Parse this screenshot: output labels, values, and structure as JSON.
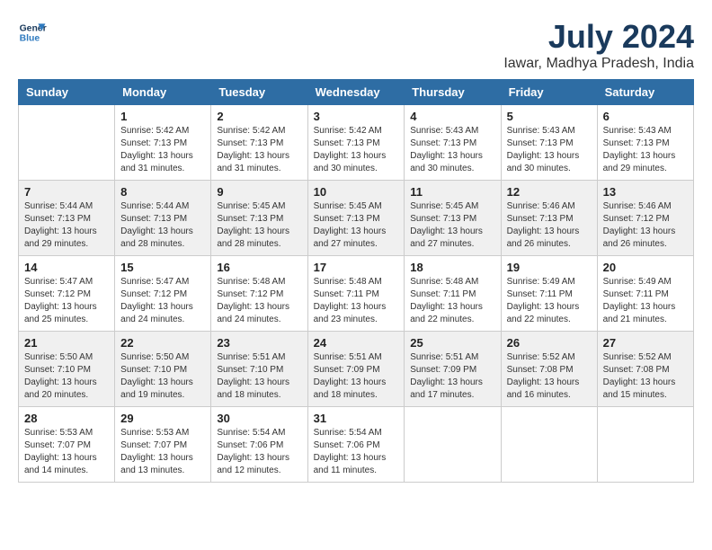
{
  "header": {
    "logo_line1": "General",
    "logo_line2": "Blue",
    "month_year": "July 2024",
    "location": "Iawar, Madhya Pradesh, India"
  },
  "days_of_week": [
    "Sunday",
    "Monday",
    "Tuesday",
    "Wednesday",
    "Thursday",
    "Friday",
    "Saturday"
  ],
  "weeks": [
    [
      {
        "day": "",
        "sunrise": "",
        "sunset": "",
        "daylight": ""
      },
      {
        "day": "1",
        "sunrise": "Sunrise: 5:42 AM",
        "sunset": "Sunset: 7:13 PM",
        "daylight": "Daylight: 13 hours and 31 minutes."
      },
      {
        "day": "2",
        "sunrise": "Sunrise: 5:42 AM",
        "sunset": "Sunset: 7:13 PM",
        "daylight": "Daylight: 13 hours and 31 minutes."
      },
      {
        "day": "3",
        "sunrise": "Sunrise: 5:42 AM",
        "sunset": "Sunset: 7:13 PM",
        "daylight": "Daylight: 13 hours and 30 minutes."
      },
      {
        "day": "4",
        "sunrise": "Sunrise: 5:43 AM",
        "sunset": "Sunset: 7:13 PM",
        "daylight": "Daylight: 13 hours and 30 minutes."
      },
      {
        "day": "5",
        "sunrise": "Sunrise: 5:43 AM",
        "sunset": "Sunset: 7:13 PM",
        "daylight": "Daylight: 13 hours and 30 minutes."
      },
      {
        "day": "6",
        "sunrise": "Sunrise: 5:43 AM",
        "sunset": "Sunset: 7:13 PM",
        "daylight": "Daylight: 13 hours and 29 minutes."
      }
    ],
    [
      {
        "day": "7",
        "sunrise": "Sunrise: 5:44 AM",
        "sunset": "Sunset: 7:13 PM",
        "daylight": "Daylight: 13 hours and 29 minutes."
      },
      {
        "day": "8",
        "sunrise": "Sunrise: 5:44 AM",
        "sunset": "Sunset: 7:13 PM",
        "daylight": "Daylight: 13 hours and 28 minutes."
      },
      {
        "day": "9",
        "sunrise": "Sunrise: 5:45 AM",
        "sunset": "Sunset: 7:13 PM",
        "daylight": "Daylight: 13 hours and 28 minutes."
      },
      {
        "day": "10",
        "sunrise": "Sunrise: 5:45 AM",
        "sunset": "Sunset: 7:13 PM",
        "daylight": "Daylight: 13 hours and 27 minutes."
      },
      {
        "day": "11",
        "sunrise": "Sunrise: 5:45 AM",
        "sunset": "Sunset: 7:13 PM",
        "daylight": "Daylight: 13 hours and 27 minutes."
      },
      {
        "day": "12",
        "sunrise": "Sunrise: 5:46 AM",
        "sunset": "Sunset: 7:13 PM",
        "daylight": "Daylight: 13 hours and 26 minutes."
      },
      {
        "day": "13",
        "sunrise": "Sunrise: 5:46 AM",
        "sunset": "Sunset: 7:12 PM",
        "daylight": "Daylight: 13 hours and 26 minutes."
      }
    ],
    [
      {
        "day": "14",
        "sunrise": "Sunrise: 5:47 AM",
        "sunset": "Sunset: 7:12 PM",
        "daylight": "Daylight: 13 hours and 25 minutes."
      },
      {
        "day": "15",
        "sunrise": "Sunrise: 5:47 AM",
        "sunset": "Sunset: 7:12 PM",
        "daylight": "Daylight: 13 hours and 24 minutes."
      },
      {
        "day": "16",
        "sunrise": "Sunrise: 5:48 AM",
        "sunset": "Sunset: 7:12 PM",
        "daylight": "Daylight: 13 hours and 24 minutes."
      },
      {
        "day": "17",
        "sunrise": "Sunrise: 5:48 AM",
        "sunset": "Sunset: 7:11 PM",
        "daylight": "Daylight: 13 hours and 23 minutes."
      },
      {
        "day": "18",
        "sunrise": "Sunrise: 5:48 AM",
        "sunset": "Sunset: 7:11 PM",
        "daylight": "Daylight: 13 hours and 22 minutes."
      },
      {
        "day": "19",
        "sunrise": "Sunrise: 5:49 AM",
        "sunset": "Sunset: 7:11 PM",
        "daylight": "Daylight: 13 hours and 22 minutes."
      },
      {
        "day": "20",
        "sunrise": "Sunrise: 5:49 AM",
        "sunset": "Sunset: 7:11 PM",
        "daylight": "Daylight: 13 hours and 21 minutes."
      }
    ],
    [
      {
        "day": "21",
        "sunrise": "Sunrise: 5:50 AM",
        "sunset": "Sunset: 7:10 PM",
        "daylight": "Daylight: 13 hours and 20 minutes."
      },
      {
        "day": "22",
        "sunrise": "Sunrise: 5:50 AM",
        "sunset": "Sunset: 7:10 PM",
        "daylight": "Daylight: 13 hours and 19 minutes."
      },
      {
        "day": "23",
        "sunrise": "Sunrise: 5:51 AM",
        "sunset": "Sunset: 7:10 PM",
        "daylight": "Daylight: 13 hours and 18 minutes."
      },
      {
        "day": "24",
        "sunrise": "Sunrise: 5:51 AM",
        "sunset": "Sunset: 7:09 PM",
        "daylight": "Daylight: 13 hours and 18 minutes."
      },
      {
        "day": "25",
        "sunrise": "Sunrise: 5:51 AM",
        "sunset": "Sunset: 7:09 PM",
        "daylight": "Daylight: 13 hours and 17 minutes."
      },
      {
        "day": "26",
        "sunrise": "Sunrise: 5:52 AM",
        "sunset": "Sunset: 7:08 PM",
        "daylight": "Daylight: 13 hours and 16 minutes."
      },
      {
        "day": "27",
        "sunrise": "Sunrise: 5:52 AM",
        "sunset": "Sunset: 7:08 PM",
        "daylight": "Daylight: 13 hours and 15 minutes."
      }
    ],
    [
      {
        "day": "28",
        "sunrise": "Sunrise: 5:53 AM",
        "sunset": "Sunset: 7:07 PM",
        "daylight": "Daylight: 13 hours and 14 minutes."
      },
      {
        "day": "29",
        "sunrise": "Sunrise: 5:53 AM",
        "sunset": "Sunset: 7:07 PM",
        "daylight": "Daylight: 13 hours and 13 minutes."
      },
      {
        "day": "30",
        "sunrise": "Sunrise: 5:54 AM",
        "sunset": "Sunset: 7:06 PM",
        "daylight": "Daylight: 13 hours and 12 minutes."
      },
      {
        "day": "31",
        "sunrise": "Sunrise: 5:54 AM",
        "sunset": "Sunset: 7:06 PM",
        "daylight": "Daylight: 13 hours and 11 minutes."
      },
      {
        "day": "",
        "sunrise": "",
        "sunset": "",
        "daylight": ""
      },
      {
        "day": "",
        "sunrise": "",
        "sunset": "",
        "daylight": ""
      },
      {
        "day": "",
        "sunrise": "",
        "sunset": "",
        "daylight": ""
      }
    ]
  ]
}
